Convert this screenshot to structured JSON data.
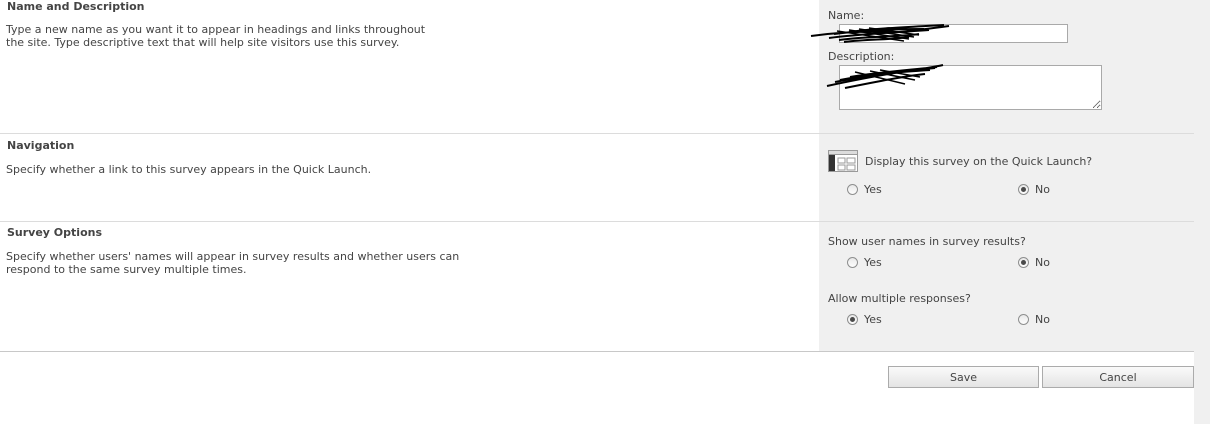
{
  "name_section": {
    "heading": "Name and Description",
    "description": "Type a new name as you want it to appear in headings and links throughout the site. Type descriptive text that will help site visitors use this survey.",
    "name_label": "Name:",
    "name_value": "",
    "description_label": "Description:",
    "description_value": ""
  },
  "navigation_section": {
    "heading": "Navigation",
    "description": "Specify whether a link to this survey appears in the Quick Launch.",
    "question": "Display this survey on the Quick Launch?",
    "options": [
      "Yes",
      "No"
    ],
    "selected": "No"
  },
  "survey_options_section": {
    "heading": "Survey Options",
    "description": "Specify whether users' names will appear in survey results and whether users can respond to the same survey multiple times.",
    "show_names_question": "Show user names in survey results?",
    "show_names_options": [
      "Yes",
      "No"
    ],
    "show_names_selected": "No",
    "multiple_responses_question": "Allow multiple responses?",
    "multiple_responses_options": [
      "Yes",
      "No"
    ],
    "multiple_responses_selected": "Yes"
  },
  "buttons": {
    "save": "Save",
    "cancel": "Cancel"
  },
  "icons": {
    "quick_launch": "quick-launch-icon"
  }
}
